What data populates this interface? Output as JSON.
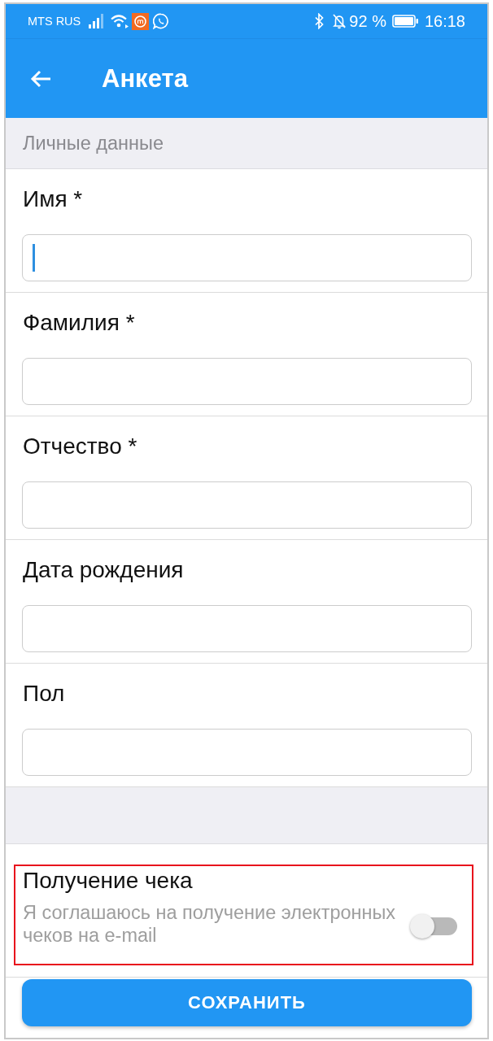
{
  "status_bar": {
    "carrier": "MTS RUS",
    "battery": "92 %",
    "time": "16:18"
  },
  "app_bar": {
    "title": "Анкета"
  },
  "section_header": "Личные данные",
  "fields": [
    {
      "label": "Имя *",
      "focused": true
    },
    {
      "label": "Фамилия *",
      "focused": false
    },
    {
      "label": "Отчество *",
      "focused": false
    },
    {
      "label": "Дата рождения",
      "focused": false
    },
    {
      "label": "Пол",
      "focused": false
    }
  ],
  "receipt": {
    "highlighted": true,
    "title": "Получение чека",
    "description": "Я соглашаюсь на получение электронных чеков на e-mail",
    "toggle": {
      "on": false
    }
  },
  "save_button": {
    "label": "СОХРАНИТЬ"
  }
}
